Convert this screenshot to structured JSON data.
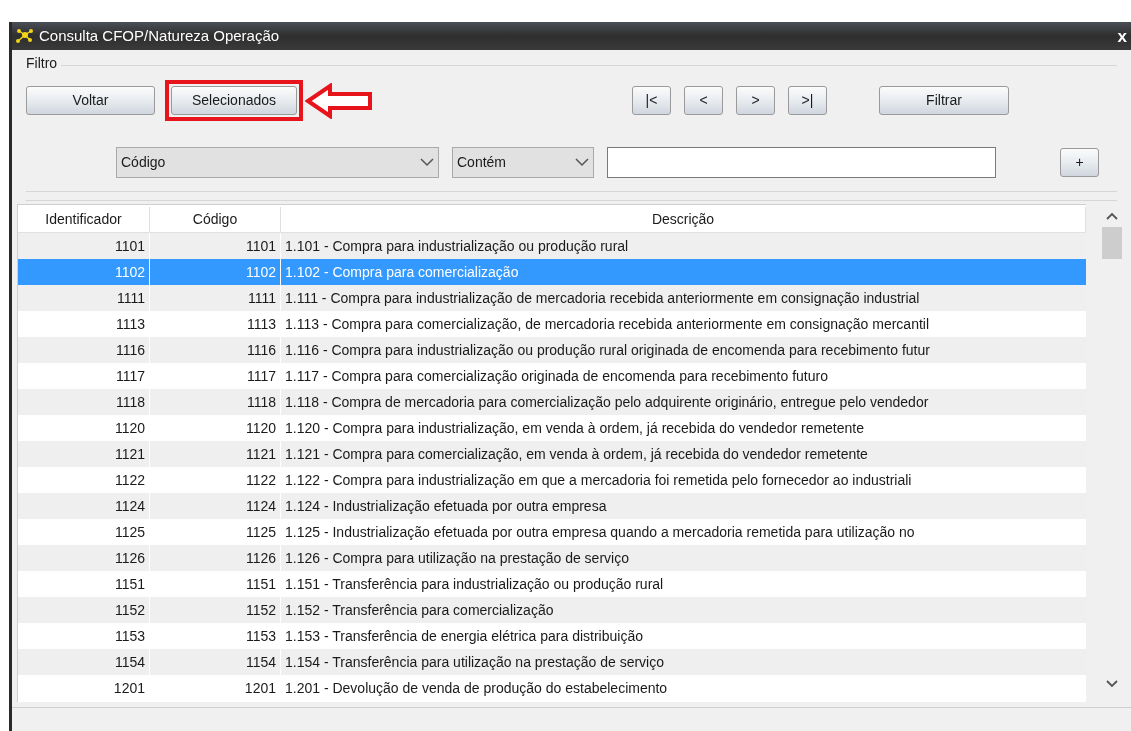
{
  "window": {
    "title": "Consulta CFOP/Natureza Operação",
    "close": "x"
  },
  "filter": {
    "label": "Filtro",
    "buttons": [
      {
        "label": "Voltar",
        "highlighted": false
      },
      {
        "label": "Selecionados",
        "highlighted": true
      }
    ],
    "nav_buttons": [
      "|<",
      "<",
      ">",
      ">|"
    ],
    "apply_button": "Filtrar",
    "field_select": "Código",
    "operator_select": "Contém",
    "add_button": "+"
  },
  "table": {
    "columns": [
      "Identificador",
      "Código",
      "Descrição"
    ],
    "rows": [
      {
        "id": "1101",
        "code": "1101",
        "description": "1.101 - Compra para industrialização ou produção rural",
        "selected": false
      },
      {
        "id": "1102",
        "code": "1102",
        "description": "1.102 - Compra para comercialização",
        "selected": true
      },
      {
        "id": "1111",
        "code": "1111",
        "description": "1.111 - Compra para industrialização de mercadoria recebida anteriormente em consignação industrial",
        "selected": false
      },
      {
        "id": "1113",
        "code": "1113",
        "description": "1.113 - Compra para comercialização, de mercadoria recebida anteriormente em consignação mercantil",
        "selected": false
      },
      {
        "id": "1116",
        "code": "1116",
        "description": "1.116 - Compra para industrialização ou produção rural originada de encomenda para recebimento futur",
        "selected": false
      },
      {
        "id": "1117",
        "code": "1117",
        "description": "1.117 - Compra para comercialização originada de encomenda para recebimento futuro",
        "selected": false
      },
      {
        "id": "1118",
        "code": "1118",
        "description": "1.118 - Compra de mercadoria para comercialização pelo adquirente originário, entregue pelo vendedor",
        "selected": false
      },
      {
        "id": "1120",
        "code": "1120",
        "description": "1.120 - Compra para industrialização, em venda à ordem, já recebida do vendedor remetente",
        "selected": false
      },
      {
        "id": "1121",
        "code": "1121",
        "description": "1.121 - Compra para comercialização, em venda à ordem, já recebida do vendedor remetente",
        "selected": false
      },
      {
        "id": "1122",
        "code": "1122",
        "description": "1.122 - Compra para industrialização em que a mercadoria foi remetida pelo fornecedor ao industriali",
        "selected": false
      },
      {
        "id": "1124",
        "code": "1124",
        "description": "1.124 - Industrialização efetuada por outra empresa",
        "selected": false
      },
      {
        "id": "1125",
        "code": "1125",
        "description": "1.125 - Industrialização efetuada por outra empresa quando a mercadoria remetida para utilização no",
        "selected": false
      },
      {
        "id": "1126",
        "code": "1126",
        "description": "1.126 - Compra para utilização na prestação de serviço",
        "selected": false
      },
      {
        "id": "1151",
        "code": "1151",
        "description": "1.151 - Transferência para industrialização ou produção rural",
        "selected": false
      },
      {
        "id": "1152",
        "code": "1152",
        "description": "1.152 - Transferência para comercialização",
        "selected": false
      },
      {
        "id": "1153",
        "code": "1153",
        "description": "1.153 - Transferência de energia elétrica para distribuição",
        "selected": false
      },
      {
        "id": "1154",
        "code": "1154",
        "description": "1.154 - Transferência para utilização na prestação de serviço",
        "selected": false
      },
      {
        "id": "1201",
        "code": "1201",
        "description": "1.201 - Devolução de venda de produção do estabelecimento",
        "selected": false
      }
    ]
  }
}
